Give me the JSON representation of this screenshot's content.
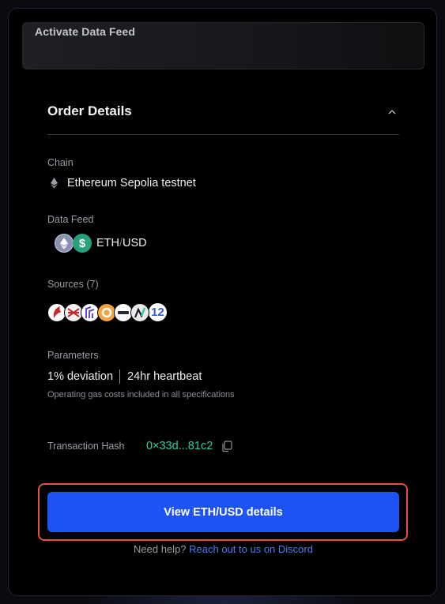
{
  "header": {
    "title": "Activate Data Feed"
  },
  "order": {
    "title": "Order Details",
    "chain": {
      "label": "Chain",
      "value": "Ethereum Sepolia testnet"
    },
    "data_feed": {
      "label": "Data Feed",
      "base": "ETH",
      "slash": "/",
      "quote": "USD"
    },
    "sources": {
      "label": "Sources (7)",
      "count_badge": "12"
    },
    "parameters": {
      "label": "Parameters",
      "deviation": "1% deviation",
      "heartbeat": "24hr heartbeat",
      "note": "Operating gas costs included in all specifications"
    },
    "transaction": {
      "label": "Transaction Hash",
      "hash": "0×33d...81c2"
    }
  },
  "cta": {
    "label": "View ETH/USD details"
  },
  "help": {
    "prefix": "Need help?",
    "link": "Reach out to us on Discord"
  },
  "colors": {
    "accent": "#1d52f5",
    "link": "#4b7bf5",
    "hash": "#2bd1a6",
    "highlight_border": "#e5523f"
  },
  "icons": [
    "chevron-up-icon",
    "ethereum-icon",
    "usd-icon",
    "copy-icon"
  ]
}
